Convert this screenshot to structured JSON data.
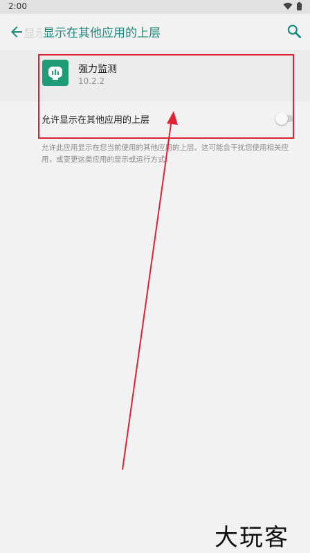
{
  "status_bar": {
    "time": "2:00",
    "icons": [
      "wifi-icon",
      "battery-icon"
    ]
  },
  "toolbar": {
    "ghost_title": "显示在",
    "title": "显示在其他应用的上层",
    "back_icon": "arrow-left-icon",
    "search_icon": "search-icon"
  },
  "app": {
    "name": "强力监测",
    "version": "10.2.2",
    "icon": "monitor-chart-icon"
  },
  "setting": {
    "label": "允许显示在其他应用的上层",
    "toggle_on": false
  },
  "description": "允许此应用显示在您当前使用的其他应用的上层。这可能会干扰您使用相关应用，或变更这类应用的显示或运行方式。",
  "watermark": "大玩客",
  "colors": {
    "accent": "#1a8a7e",
    "highlight": "#e02232",
    "app_icon_bg": "#1f9c77"
  }
}
